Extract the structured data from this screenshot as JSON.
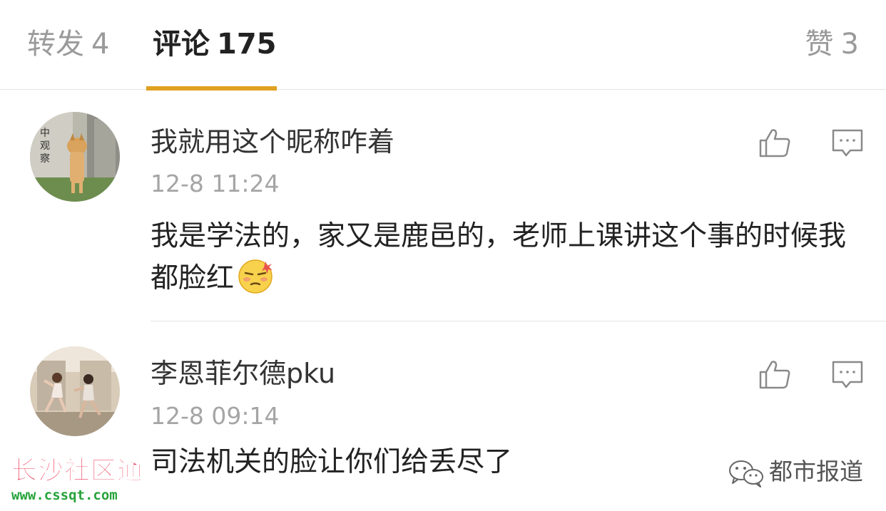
{
  "tabs": {
    "repost": {
      "label": "转发",
      "count": "4"
    },
    "comments": {
      "label": "评论",
      "count": "175"
    },
    "likes": {
      "label": "赞",
      "count": "3"
    }
  },
  "accent_color": "#e0a020",
  "comments": [
    {
      "username": "我就用这个昵称咋着",
      "timestamp": "12-8 11:24",
      "text": "我是学法的，家又是鹿邑的，老师上课讲这个事的时候我都脸红",
      "emoji": "blush-emoji",
      "avatar_text": "中观察"
    },
    {
      "username": "李恩菲尔德pku",
      "timestamp": "12-8 09:14",
      "text": "司法机关的脸让你们给丢尽了"
    }
  ],
  "watermarks": {
    "left_title": "长沙社区通",
    "left_url": "www.cssqt.com",
    "right_brand": "都市报道"
  }
}
